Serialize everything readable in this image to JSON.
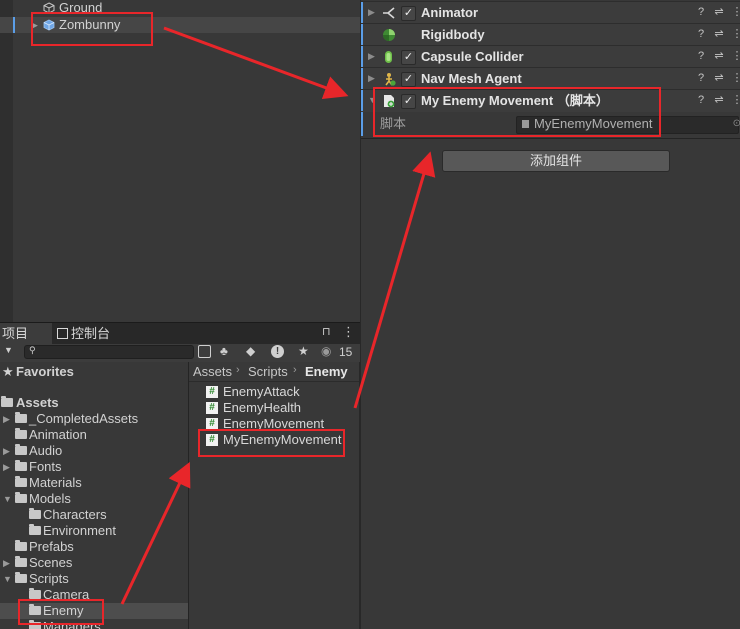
{
  "hierarchy": {
    "items": [
      {
        "label": "Ground"
      },
      {
        "label": "Zombunny"
      }
    ]
  },
  "project": {
    "tabs": [
      {
        "label": "项目"
      },
      {
        "label": "控制台"
      }
    ],
    "badge_count": "15",
    "tree": {
      "favorites": "Favorites",
      "assets": "Assets",
      "folders": [
        "_CompletedAssets",
        "Animation",
        "Audio",
        "Fonts",
        "Materials",
        "Models",
        "Characters",
        "Environment",
        "Prefabs",
        "Scenes",
        "Scripts",
        "Camera",
        "Enemy",
        "Managers"
      ]
    },
    "breadcrumb": [
      "Assets",
      "Scripts",
      "Enemy"
    ],
    "files": [
      "EnemyAttack",
      "EnemyHealth",
      "EnemyMovement",
      "MyEnemyMovement"
    ]
  },
  "inspector": {
    "components": [
      {
        "name": "Animator"
      },
      {
        "name": "Rigidbody"
      },
      {
        "name": "Capsule Collider"
      },
      {
        "name": "Nav Mesh Agent"
      },
      {
        "name": "My Enemy Movement （脚本）"
      }
    ],
    "script_label": "脚本",
    "script_value": "MyEnemyMovement",
    "add_component": "添加组件"
  },
  "colors": {
    "annotation": "#e8262a",
    "accent": "#5b9ee8",
    "panel": "#383838"
  }
}
